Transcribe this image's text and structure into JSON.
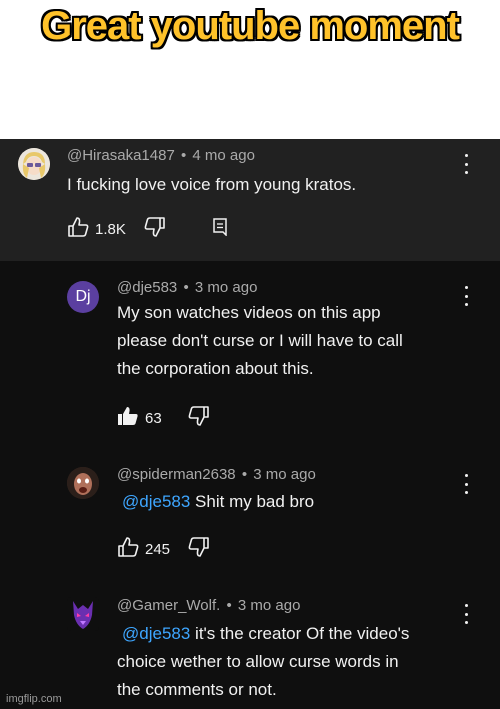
{
  "caption": "Great youtube moment",
  "watermark": "imgflip.com",
  "comments": [
    {
      "handle": "@Hirasaka1487",
      "sep": "•",
      "age": "4 mo ago",
      "text": "I fucking love voice from young kratos.",
      "likes": "1.8K",
      "icons": [
        "thumbs-up-outline-icon",
        "thumbs-down-icon",
        "reply-icon",
        "more-vertical-icon"
      ]
    },
    {
      "handle": "@dje583",
      "avatar_text": "Dj",
      "sep": "•",
      "age": "3 mo ago",
      "text_lines": [
        "My son watches videos on this app",
        "please don't curse or I will have to call",
        "the corporation about this."
      ],
      "likes": "63",
      "liked": true,
      "icons": [
        "thumbs-up-filled-icon",
        "thumbs-down-icon",
        "more-vertical-icon"
      ]
    },
    {
      "handle": "@spiderman2638",
      "sep": "•",
      "age": "3 mo ago",
      "mention": "@dje583",
      "text": "Shit my bad bro",
      "likes": "245",
      "icons": [
        "thumbs-up-outline-icon",
        "thumbs-down-icon",
        "more-vertical-icon"
      ]
    },
    {
      "handle": "@Gamer_Wolf.",
      "sep": "•",
      "age": "3 mo ago",
      "mention": "@dje583",
      "text_first": "it's the creator Of the video's",
      "text_lines_rest": [
        "choice wether to allow curse words in",
        "the comments or not."
      ],
      "icons": [
        "more-vertical-icon"
      ]
    }
  ],
  "colors": {
    "caption": "#ffc22a",
    "background": "#0f0f0f",
    "highlight": "#212121",
    "mention": "#3ea6ff",
    "dj_avatar": "#5b3fa0"
  }
}
